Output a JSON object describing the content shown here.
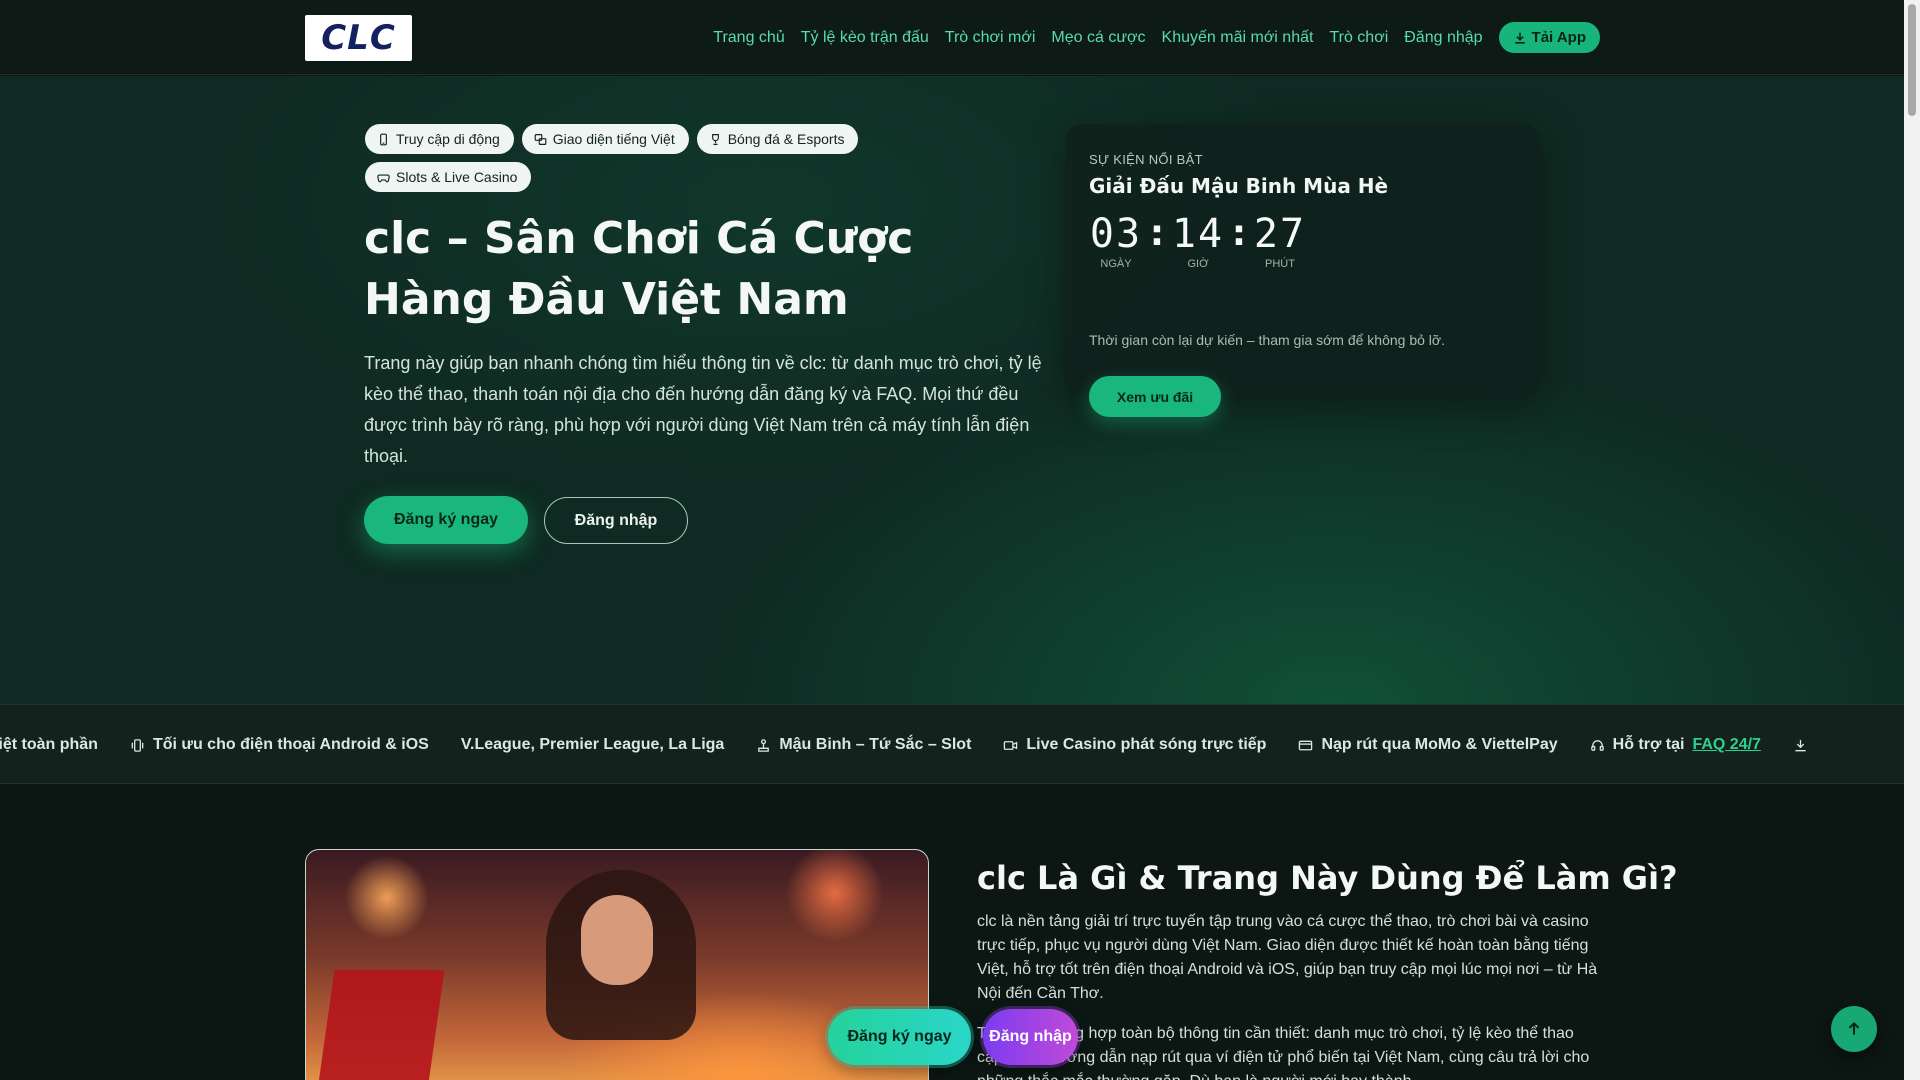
{
  "header": {
    "logo_text": "CLC",
    "nav": [
      "Trang chủ",
      "Tỷ lệ kèo trận đấu",
      "Trò chơi mới",
      "Mẹo cá cược",
      "Khuyến mãi mới nhất",
      "Trò chơi",
      "Đăng nhập"
    ],
    "app_button": "Tải App"
  },
  "hero": {
    "chips": [
      "Truy cập di động",
      "Giao diện tiếng Việt",
      "Bóng đá & Esports",
      "Slots & Live Casino"
    ],
    "title": "clc – Sân Chơi Cá Cược Hàng Đầu Việt Nam",
    "description": "Trang này giúp bạn nhanh chóng tìm hiểu thông tin về clc: từ danh mục trò chơi, tỷ lệ kèo thể thao, thanh toán nội địa cho đến hướng dẫn đăng ký và FAQ. Mọi thứ đều được trình bày rõ ràng, phù hợp với người dùng Việt Nam trên cả máy tính lẫn điện thoại.",
    "primary_button": "Đăng ký ngay",
    "secondary_button": "Đăng nhập"
  },
  "event": {
    "kicker": "SỰ KIỆN NỔI BẬT",
    "title": "Giải Đấu Mậu Binh Mùa Hè",
    "countdown": [
      {
        "value": "03",
        "label": "NGÀY"
      },
      {
        "value": "14",
        "label": "GIỜ"
      },
      {
        "value": "27",
        "label": "PHÚT"
      }
    ],
    "separator": ":",
    "note": "Thời gian còn lại dự kiến – tham gia sớm để không bỏ lỡ.",
    "button": "Xem ưu đãi"
  },
  "ticker": {
    "items": [
      {
        "text": "Việt toàn phần",
        "icon": "none"
      },
      {
        "text": "Tối ưu cho điện thoại Android & iOS",
        "icon": "vibrate-icon"
      },
      {
        "text": "V.League, Premier League, La Liga",
        "icon": "none"
      },
      {
        "text": "Mậu Binh – Tứ Sắc – Slot",
        "icon": "joystick-icon"
      },
      {
        "text": "Live Casino phát sóng trực tiếp",
        "icon": "video-icon"
      },
      {
        "text": "Nạp rút qua MoMo & ViettelPay",
        "icon": "card-icon"
      },
      {
        "text": "Hỗ trợ tại",
        "icon": "headset-icon",
        "link": "FAQ 24/7"
      }
    ]
  },
  "about": {
    "title": "clc Là Gì & Trang Này Dùng Để Làm Gì?",
    "p1": "clc là nền tảng giải trí trực tuyến tập trung vào cá cược thể thao, trò chơi bài và casino trực tiếp, phục vụ người dùng Việt Nam. Giao diện được thiết kế hoàn toàn bằng tiếng Việt, hỗ trợ tốt trên điện thoại Android và iOS, giúp bạn truy cập mọi lúc mọi nơi – từ Hà Nội đến Cần Thơ.",
    "p2": "Trang này tổng hợp toàn bộ thông tin cần thiết: danh mục trò chơi, tỷ lệ kèo thể thao cập nhật, hướng dẫn nạp rút qua ví điện tử phổ biến tại Việt Nam, cùng câu trả lời cho những thắc mắc thường gặp. Dù bạn là người mới hay thành"
  },
  "floating": {
    "register": "Đăng ký ngay",
    "login": "Đăng nhập"
  },
  "colors": {
    "accent": "#19b77e",
    "nav_link": "#57dcab",
    "background": "#0c1613"
  }
}
